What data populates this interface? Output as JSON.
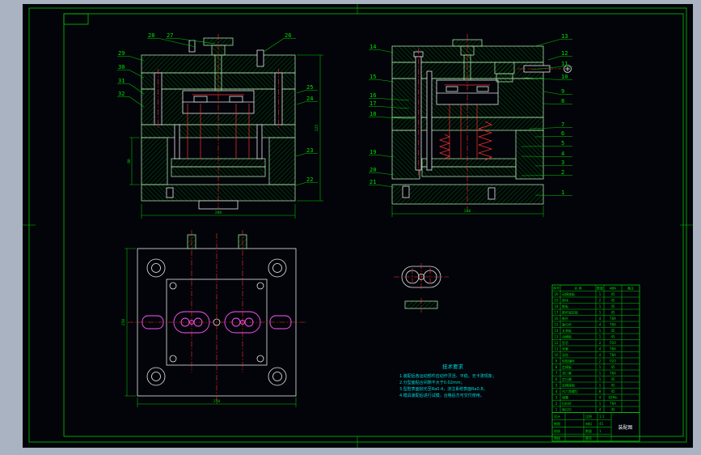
{
  "window": {
    "bg": "#a9b3c1",
    "canvas_bg": "#020409",
    "frame_color": "#00c800"
  },
  "view1": {
    "callouts_top": [
      "28",
      "27",
      "26"
    ],
    "callouts_left": [
      "29",
      "30",
      "31",
      "32"
    ],
    "callouts_right": [
      "25",
      "24",
      "23",
      "22"
    ],
    "dim_width": "200",
    "dim_height": "225",
    "dim_spacer": "80"
  },
  "view2": {
    "callouts_left": [
      "14",
      "15",
      "16",
      "17",
      "18",
      "19",
      "20",
      "21"
    ],
    "callouts_right": [
      "13",
      "12",
      "11",
      "10",
      "9",
      "8",
      "7",
      "6",
      "5",
      "4",
      "3",
      "2",
      "1"
    ],
    "dim_width": "200"
  },
  "view3": {
    "dim_left": "250",
    "dim_bottom": "250"
  },
  "notes": {
    "title": "技术要求",
    "lines": [
      "1.装配后各运动部件应动作灵活、平稳，无卡滞现象；",
      "2.分型面贴合间隙不大于0.02mm；",
      "3.型腔表面抛光至Ra0.4，浇注系统表面Ra0.8；",
      "4.模具装配后进行试模，合格后方可交付使用。"
    ]
  },
  "parts_table": {
    "headers": [
      "序号",
      "名  称",
      "数量",
      "材料",
      "备注"
    ],
    "rows": [
      [
        "20",
        "动模座板",
        "1",
        "45",
        ""
      ],
      [
        "19",
        "垫块",
        "2",
        "45",
        ""
      ],
      [
        "18",
        "推板",
        "1",
        "45",
        ""
      ],
      [
        "17",
        "推杆固定板",
        "1",
        "45",
        ""
      ],
      [
        "16",
        "推杆",
        "4",
        "T8A",
        ""
      ],
      [
        "15",
        "复位杆",
        "4",
        "T8A",
        ""
      ],
      [
        "14",
        "支承板",
        "1",
        "45",
        ""
      ],
      [
        "13",
        "动模板",
        "1",
        "45",
        ""
      ],
      [
        "12",
        "型芯",
        "2",
        "P20",
        ""
      ],
      [
        "11",
        "导套",
        "4",
        "T8A",
        ""
      ],
      [
        "10",
        "导柱",
        "4",
        "T8A",
        ""
      ],
      [
        "9",
        "型腔镶件",
        "2",
        "P20",
        ""
      ],
      [
        "8",
        "定模板",
        "1",
        "45",
        ""
      ],
      [
        "7",
        "浇口套",
        "1",
        "T8A",
        ""
      ],
      [
        "6",
        "定位圈",
        "1",
        "45",
        ""
      ],
      [
        "5",
        "定模座板",
        "1",
        "45",
        ""
      ],
      [
        "4",
        "内六角螺钉",
        "8",
        "45",
        ""
      ],
      [
        "3",
        "弹簧",
        "4",
        "65Mn",
        ""
      ],
      [
        "2",
        "拉料杆",
        "1",
        "T8A",
        ""
      ],
      [
        "1",
        "限位钉",
        "4",
        "45",
        ""
      ]
    ]
  },
  "title_block": {
    "labels": {
      "design": "设计",
      "draft": "制图",
      "check": "校核",
      "approve": "审核",
      "scale": "比例",
      "material": "材料",
      "qty": "数量",
      "sheet": "图号"
    },
    "values": {
      "scale": "1:1",
      "material": "45",
      "qty": "1"
    },
    "drawing_title": "装配图"
  }
}
